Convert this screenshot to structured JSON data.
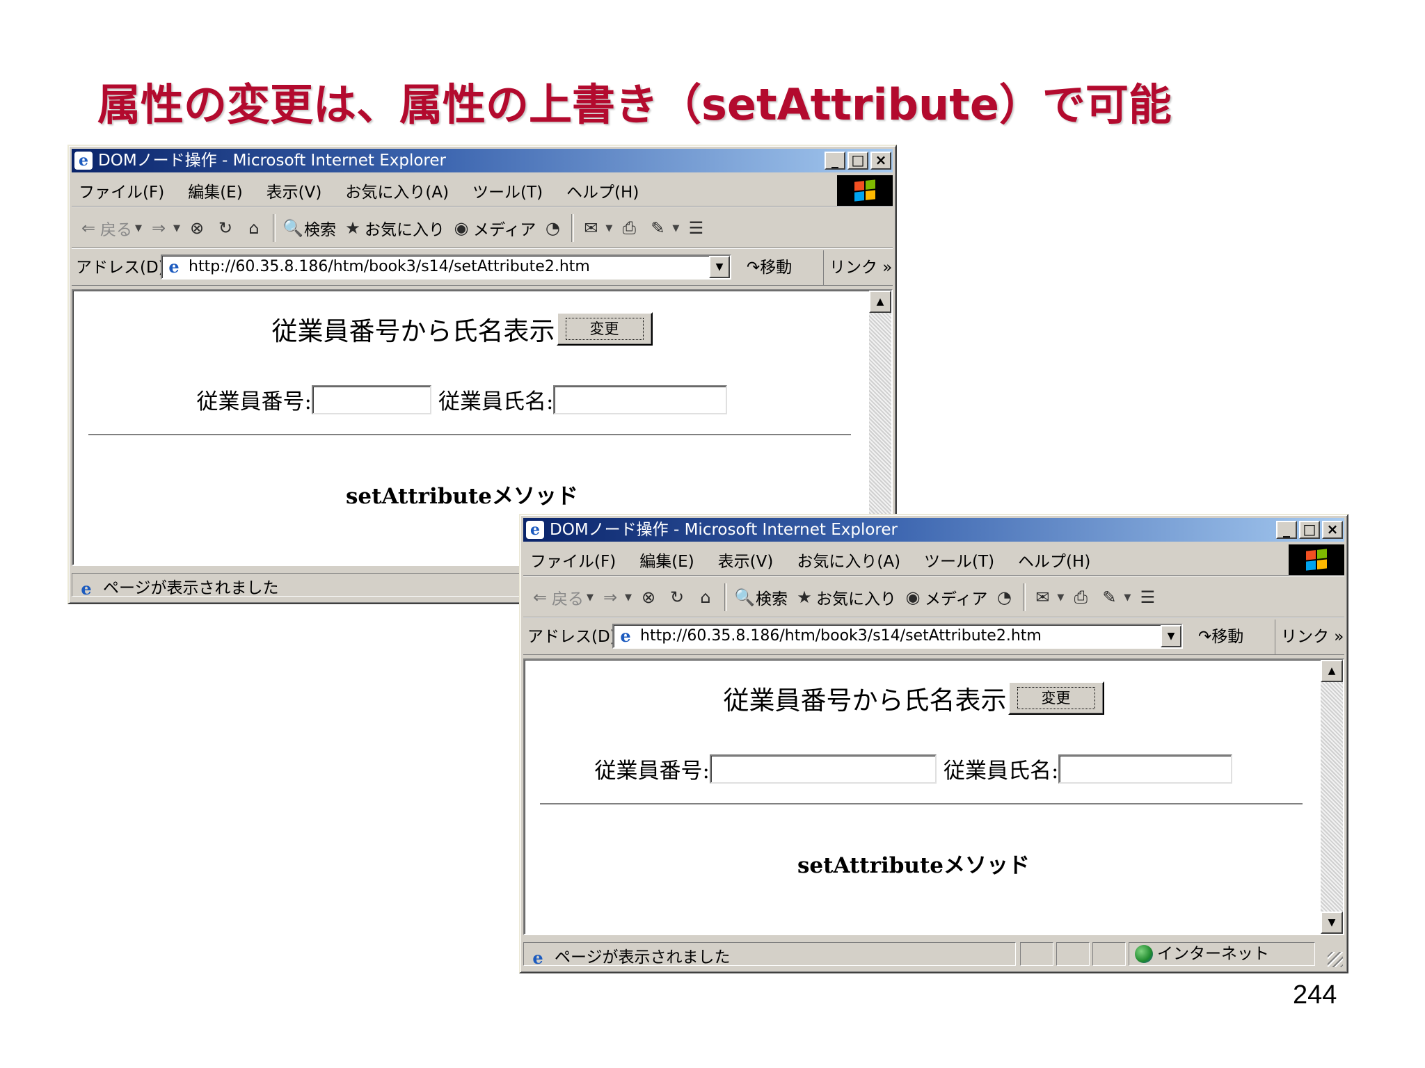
{
  "slide": {
    "title": "属性の変更は、属性の上書き（setAttribute）で可能",
    "page_number": "244"
  },
  "browser": {
    "window_title": "DOMノード操作 - Microsoft Internet Explorer",
    "caption_buttons": {
      "minimize": "_",
      "maximize": "□",
      "close": "×"
    },
    "menu": [
      "ファイル(F)",
      "編集(E)",
      "表示(V)",
      "お気に入り(A)",
      "ツール(T)",
      "ヘルプ(H)"
    ],
    "toolbar": {
      "back": "戻る",
      "search": "検索",
      "favorites": "お気に入り",
      "media": "メディア"
    },
    "address": {
      "label": "アドレス(D)",
      "url": "http://60.35.8.186/htm/book3/s14/setAttribute2.htm",
      "go": "移動",
      "links": "リンク »"
    },
    "page": {
      "heading": "従業員番号から氏名表示",
      "button": "変更",
      "employee_number_label": "従業員番号:",
      "employee_number_value": "",
      "employee_name_label": "従業員氏名:",
      "employee_name_value": "",
      "method_text": "setAttributeメソッド"
    },
    "status": {
      "text": "ページが表示されました",
      "zone": "インターネット"
    }
  },
  "icons": {
    "ie": "e",
    "back": "⇐",
    "forward": "⇒",
    "stop": "⊗",
    "refresh": "↻",
    "home": "⌂",
    "search": "🔍",
    "favorites": "★",
    "media": "◉",
    "history": "◔",
    "mail": "✉",
    "print": "⎙",
    "edit": "✎",
    "discuss": "☰",
    "go": "↷",
    "dropdown": "▼",
    "up": "▲"
  },
  "colors": {
    "title": "#b30a2e",
    "titlebar_start": "#0a246a",
    "titlebar_end": "#a6caf0",
    "chrome": "#d4d0c8"
  }
}
